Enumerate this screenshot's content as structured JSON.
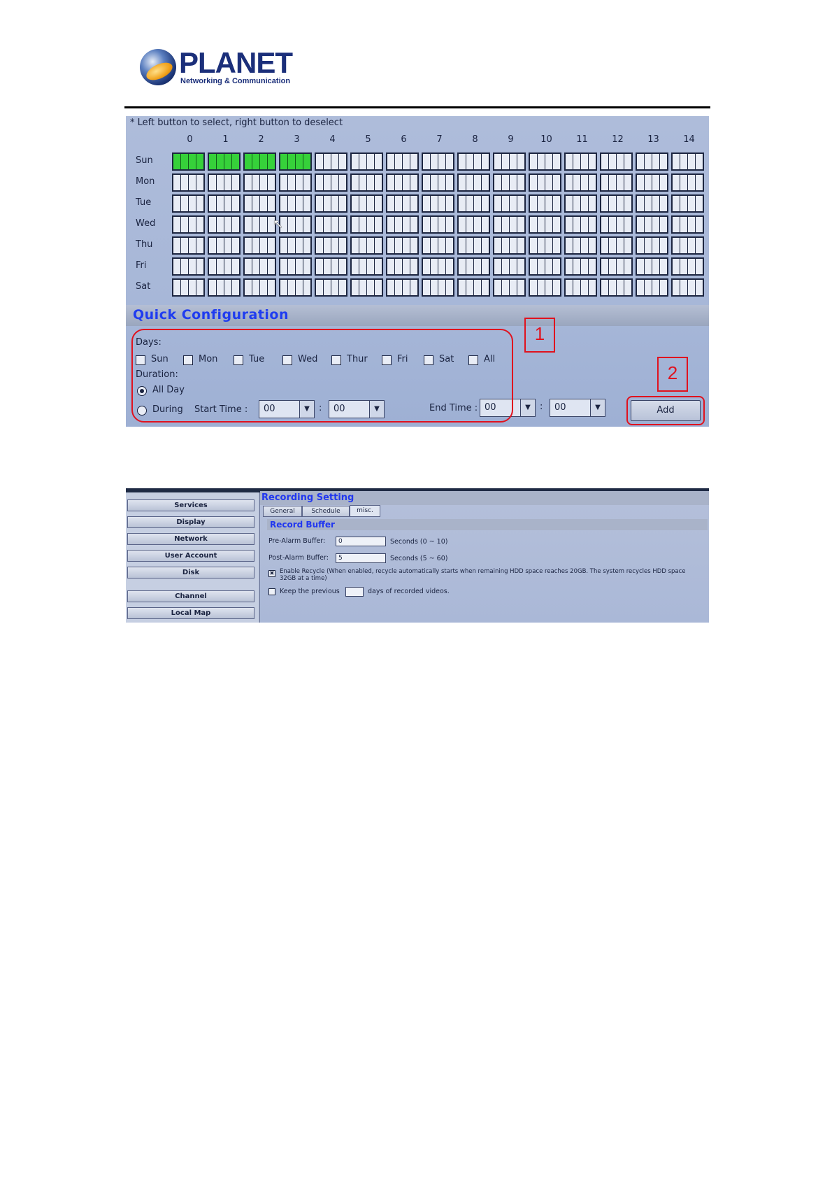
{
  "logo": {
    "wordmark": "PLANET",
    "tagline": "Networking & Communication"
  },
  "schedule": {
    "hint": "* Left button to select, right button to deselect",
    "hours": [
      "0",
      "1",
      "2",
      "3",
      "4",
      "5",
      "6",
      "7",
      "8",
      "9",
      "10",
      "11",
      "12",
      "13",
      "14"
    ],
    "days": [
      "Sun",
      "Mon",
      "Tue",
      "Wed",
      "Thu",
      "Fri",
      "Sat"
    ],
    "selected": {
      "Sun": [
        0,
        1,
        2,
        3
      ]
    },
    "selected_color": "#36d13a"
  },
  "quick_config": {
    "title": "Quick Configuration",
    "days_label": "Days:",
    "day_options": [
      "Sun",
      "Mon",
      "Tue",
      "Wed",
      "Thur",
      "Fri",
      "Sat",
      "All"
    ],
    "duration_label": "Duration:",
    "all_day_label": "All Day",
    "during_label": "During",
    "duration_selected": "All Day",
    "start_time_label": "Start Time :",
    "end_time_label": "End Time :",
    "start_hour": "00",
    "start_min": "00",
    "end_hour": "00",
    "end_min": "00",
    "colon": ":",
    "add_label": "Add"
  },
  "callouts": {
    "one": "1",
    "two": "2",
    "color": "#e0121e"
  },
  "recording": {
    "sidebar": [
      "Services",
      "Display",
      "Network",
      "User Account",
      "Disk",
      "Channel",
      "Local Map"
    ],
    "title": "Recording Setting",
    "tabs": [
      "General",
      "Schedule",
      "misc."
    ],
    "active_tab": "misc.",
    "section_title": "Record Buffer",
    "pre_alarm_label": "Pre-Alarm Buffer:",
    "pre_alarm_value": "0",
    "pre_alarm_range": "Seconds (0 ~ 10)",
    "post_alarm_label": "Post-Alarm Buffer:",
    "post_alarm_value": "5",
    "post_alarm_range": "Seconds (5 ~ 60)",
    "recycle_label": "Enable Recycle (When enabled, recycle automatically starts when remaining HDD space reaches 20GB. The system recycles HDD space 32GB at a time)",
    "recycle_checked": true,
    "keep_label": "Keep the previous",
    "keep_value": "",
    "keep_suffix": "days of recorded videos.",
    "keep_checked": false
  }
}
